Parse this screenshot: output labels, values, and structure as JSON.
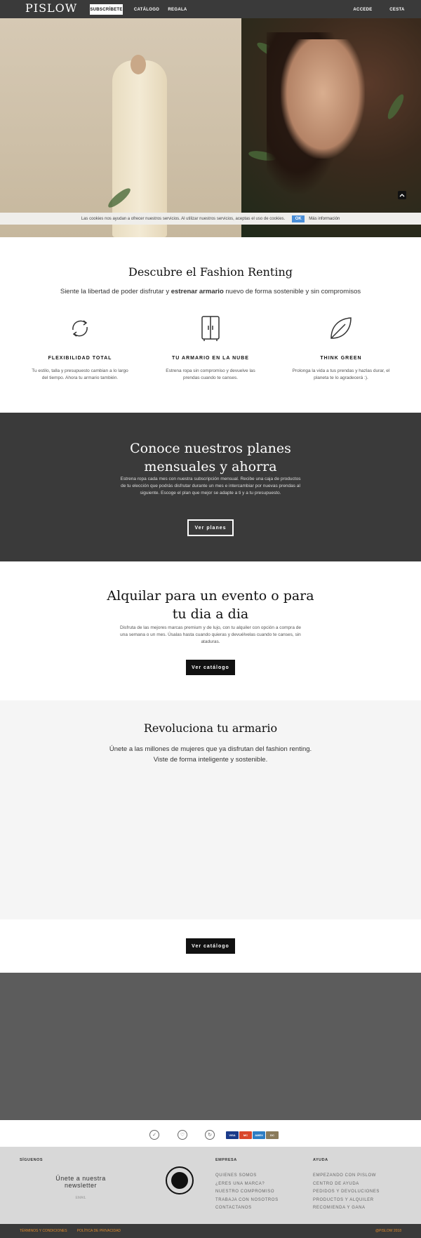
{
  "header": {
    "logo": "PISLOW",
    "nav": {
      "subscribe": "SUBSCRÍBETE",
      "catalog": "CATÁLOGO",
      "gift": "REGALA",
      "login": "ACCEDE",
      "cart": "CESTA"
    }
  },
  "cookie_bar": {
    "text": "Las cookies nos ayudan a ofrecer nuestros servicios. Al utilizar nuestros servicios, aceptas el uso de cookies.",
    "ok": "OK",
    "more": "Más información"
  },
  "intro": {
    "title": "Descubre el Fashion Renting",
    "subtitle_pre": "Siente la libertad de poder disfrutar y ",
    "subtitle_bold": "estrenar armario",
    "subtitle_post": " nuevo de forma sostenible y sin compromisos",
    "features": [
      {
        "icon": "refresh-icon",
        "title": "FLEXIBILIDAD TOTAL",
        "text": "Tu estilo, talla y presupuesto cambian a lo largo del tiempo. Ahora tu armario también."
      },
      {
        "icon": "wardrobe-icon",
        "title": "TU ARMARIO EN LA NUBE",
        "text": "Estrena ropa sin compromiso y devuelve las prendas cuando te canses."
      },
      {
        "icon": "leaf-icon",
        "title": "THINK GREEN",
        "text": "Prolonga la vida a tus prendas y hazlas durar, el planeta te lo agradecerá :)."
      }
    ]
  },
  "plans": {
    "title": "Conoce nuestros planes mensuales y ahorra",
    "text": "Estrena ropa cada mes con nuestra subscripción mensual. Recibe una caja de productos de tu elección que podrás disfrutar durante un mes e intercambiar por nuevas prendas al siguiente. Escoge el plan que mejor se adapte a ti y a tu presupuesto.",
    "button": "Ver planes"
  },
  "event": {
    "title": "Alquilar para un evento o para tu dia a dia",
    "text": "Disfruta de las mejores marcas premium y de lujo, con tu alquiler con opción a compra de una semana o un mes. Úsalas hasta cuando quieras y devuélvelas cuando te canses, sin ataduras.",
    "button": "Ver catálogo"
  },
  "revolution": {
    "title": "Revoluciona tu armario",
    "text": "Únete a las millones de mujeres que ya disfrutan del fashion renting. Viste de forma inteligente y sostenible.",
    "button": "Ver catálogo"
  },
  "payments": {
    "cards": [
      "VISA",
      "MC",
      "AMEX",
      "DC"
    ]
  },
  "footer": {
    "follow": "SÍGUENOS",
    "newsletter": "Únete a nuestra newsletter",
    "email_placeholder": "EMAIL",
    "company_head": "EMPRESA",
    "company_links": [
      "QUIENES SOMOS",
      "¿ERES UNA MARCA?",
      "NUESTRO COMPROMISO",
      "TRABAJA CON NOSOTROS",
      "CONTACTANOS"
    ],
    "help_head": "AYUDA",
    "help_links": [
      "EMPEZANDO CON PISLOW",
      "CENTRO DE AYUDA",
      "PEDIDOS Y DEVOLUCIONES",
      "PRODUCTOS Y ALQUILER",
      "RECOMIENDA Y GANA"
    ],
    "terms": "TÉRMINOS Y CONDICIONES",
    "privacy": "POLÍTICA DE PRIVACIDAD",
    "copyright": "@PISLOW 2018"
  },
  "colors": {
    "dark": "#3a3a3a",
    "accent_orange": "#e08a2c",
    "cookie_ok": "#4a8fd8"
  }
}
